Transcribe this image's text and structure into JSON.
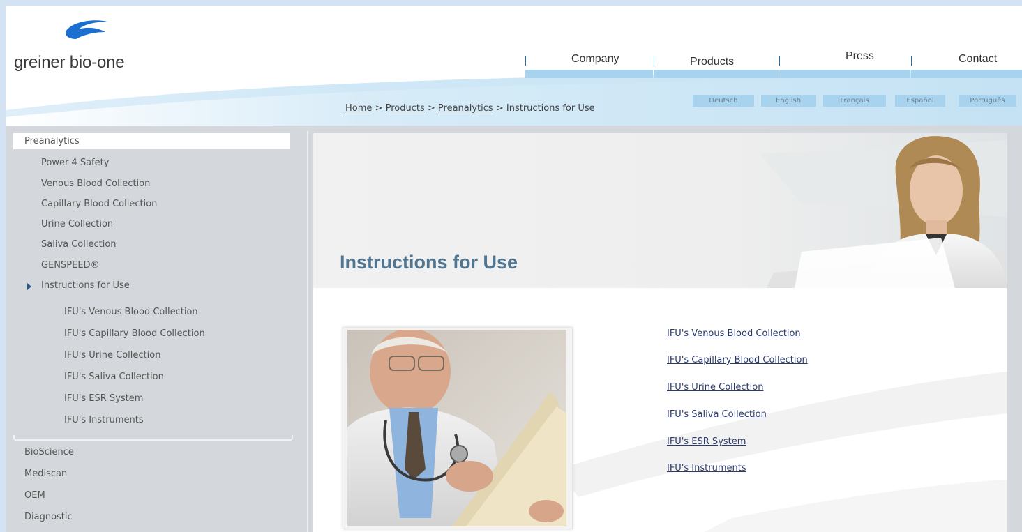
{
  "brand": {
    "name": "greiner bio-one"
  },
  "colors": {
    "accent_blue": "#1a6fb5",
    "nav_bar": "#a7d3ee",
    "title_blue": "#4f7591",
    "link_color": "#2b3a6b",
    "sidebar_bg": "#d4d8dc"
  },
  "nav": {
    "items": [
      {
        "label": "Company"
      },
      {
        "label": "Products"
      },
      {
        "label": "Press"
      },
      {
        "label": "Contact"
      }
    ]
  },
  "languages": [
    "Deutsch",
    "English",
    "Français",
    "Español",
    "Português"
  ],
  "breadcrumb": {
    "home": "Home",
    "products": "Products",
    "preanalytics": "Preanalytics",
    "current": "Instructions for Use",
    "separator": ">"
  },
  "sidebar": {
    "section": "Preanalytics",
    "items": [
      "Power 4 Safety",
      "Venous Blood Collection",
      "Capillary Blood Collection",
      "Urine Collection",
      "Saliva Collection",
      "GENSPEED®",
      "Instructions for Use"
    ],
    "subitems": [
      "IFU's Venous Blood Collection",
      "IFU's Capillary Blood Collection",
      "IFU's Urine Collection",
      "IFU's Saliva Collection",
      "IFU's ESR System",
      "IFU's Instruments"
    ],
    "other_sections": [
      "BioScience",
      "Mediscan",
      "OEM",
      "Diagnostic"
    ]
  },
  "main": {
    "title": "Instructions for Use",
    "links": [
      "IFU's Venous Blood Collection",
      "IFU's Capillary Blood Collection",
      "IFU's Urine Collection",
      "IFU's Saliva Collection",
      "IFU's ESR System",
      "IFU's Instruments"
    ]
  }
}
